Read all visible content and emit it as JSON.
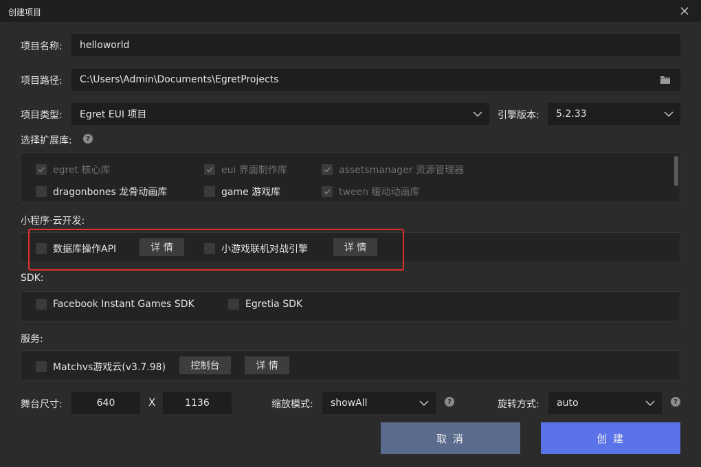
{
  "window": {
    "title": "创建项目"
  },
  "project_name": {
    "label": "项目名称:",
    "value": "helloworld"
  },
  "project_path": {
    "label": "项目路径:",
    "value": "C:\\Users\\Admin\\Documents\\EgretProjects"
  },
  "project_type": {
    "label": "项目类型:",
    "value": "Egret EUI 项目"
  },
  "engine_version": {
    "label": "引擎版本:",
    "value": "5.2.33"
  },
  "extensions": {
    "label": "选择扩展库:",
    "items": [
      {
        "label": "egret 核心库",
        "checked": true,
        "disabled": true
      },
      {
        "label": "eui 界面制作库",
        "checked": true,
        "disabled": true
      },
      {
        "label": "assetsmanager 资源管理器",
        "checked": true,
        "disabled": true
      },
      {
        "label": "dragonbones 龙骨动画库",
        "checked": false,
        "disabled": false
      },
      {
        "label": "game 游戏库",
        "checked": false,
        "disabled": false
      },
      {
        "label": "tween 缓动动画库",
        "checked": true,
        "disabled": true
      }
    ]
  },
  "cloud": {
    "label": "小程序·云开发:",
    "items": [
      {
        "label": "数据库操作API",
        "button": "详 情"
      },
      {
        "label": "小游戏联机对战引擎",
        "button": "详 情"
      }
    ]
  },
  "sdk": {
    "label": "SDK:",
    "items": [
      {
        "label": "Facebook Instant Games SDK"
      },
      {
        "label": "Egretia SDK"
      }
    ]
  },
  "services": {
    "label": "服务:",
    "item": "Matchvs游戏云(v3.7.98)",
    "console_button": "控制台",
    "detail_button": "详 情"
  },
  "stage": {
    "label": "舞台尺寸:",
    "width": "640",
    "separator": "X",
    "height": "1136"
  },
  "scale_mode": {
    "label": "缩放模式:",
    "value": "showAll"
  },
  "orientation": {
    "label": "旋转方式:",
    "value": "auto"
  },
  "actions": {
    "cancel": "取 消",
    "create": "创 建"
  },
  "colors": {
    "background": "#2b2b2b",
    "field": "#1e1e1e",
    "cancel_button": "#5b6b8c",
    "create_button": "#5a73e8",
    "highlight": "#e0302c"
  },
  "icons": [
    "close-icon",
    "folder-icon",
    "chevron-down-icon",
    "help-icon",
    "check-icon"
  ]
}
